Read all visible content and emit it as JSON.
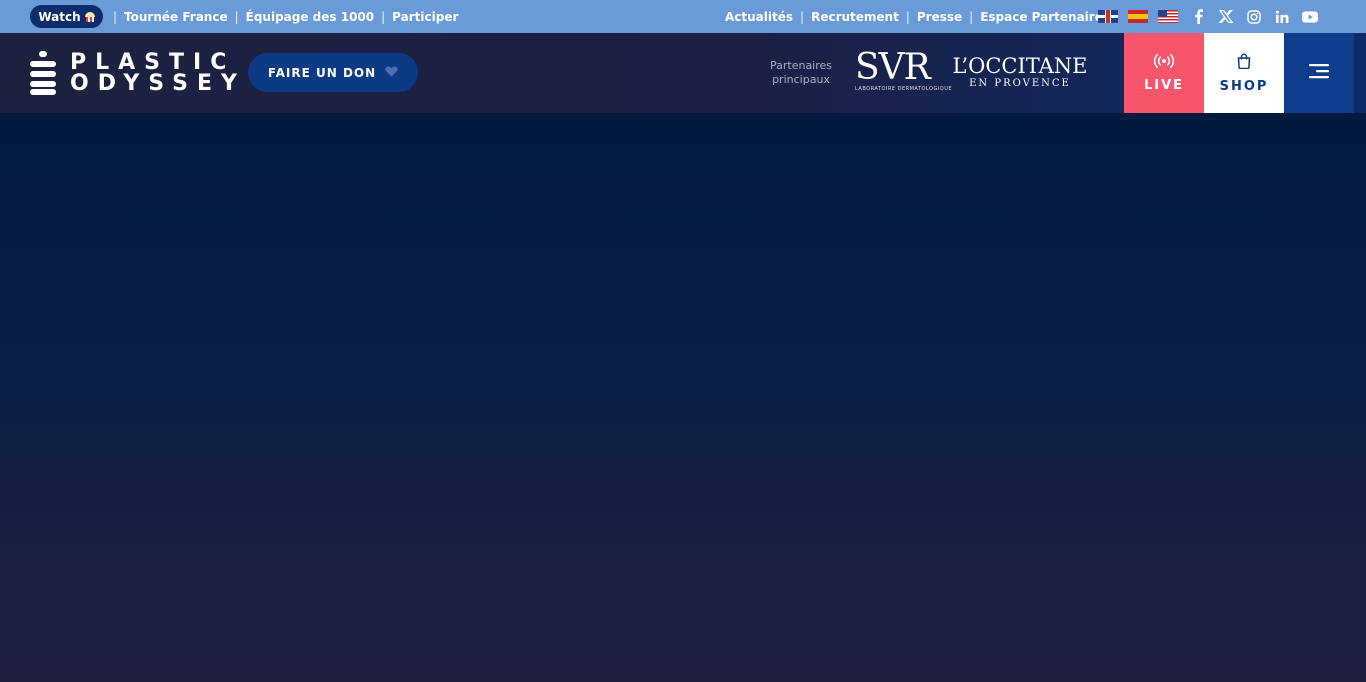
{
  "topbar": {
    "watch_label": "Watch",
    "left_links": [
      "Tournée France",
      "Équipage des 1000",
      "Participer"
    ],
    "right_links": [
      "Actualités",
      "Recrutement",
      "Presse",
      "Espace Partenaire"
    ],
    "separator": "|",
    "flags": [
      "uk-flag",
      "spain-flag",
      "usa-flag"
    ],
    "socials": [
      "facebook-icon",
      "x-icon",
      "instagram-icon",
      "linkedin-icon",
      "youtube-icon"
    ]
  },
  "header": {
    "logo_line1": "PLASTIC",
    "logo_line2": "ODYSSEY",
    "donate_label": "FAIRE UN DON",
    "partners_label_1": "Partenaires",
    "partners_label_2": "principaux",
    "svr_text": "SVR",
    "svr_sub": "LABORATOIRE DERMATOLOGIQUE",
    "occitane_text": "L’OCCITANE",
    "occitane_sub": "EN PROVENCE",
    "live_label": "LIVE",
    "shop_label": "SHOP"
  },
  "colors": {
    "topbar": "#6a9bd8",
    "watch_pill": "#0c2c6a",
    "live": "#f6566b",
    "shop": "#ffffff",
    "menu": "#0f3d8c",
    "hero_top": "#04193e",
    "hero_bottom": "#1f1f3e"
  }
}
